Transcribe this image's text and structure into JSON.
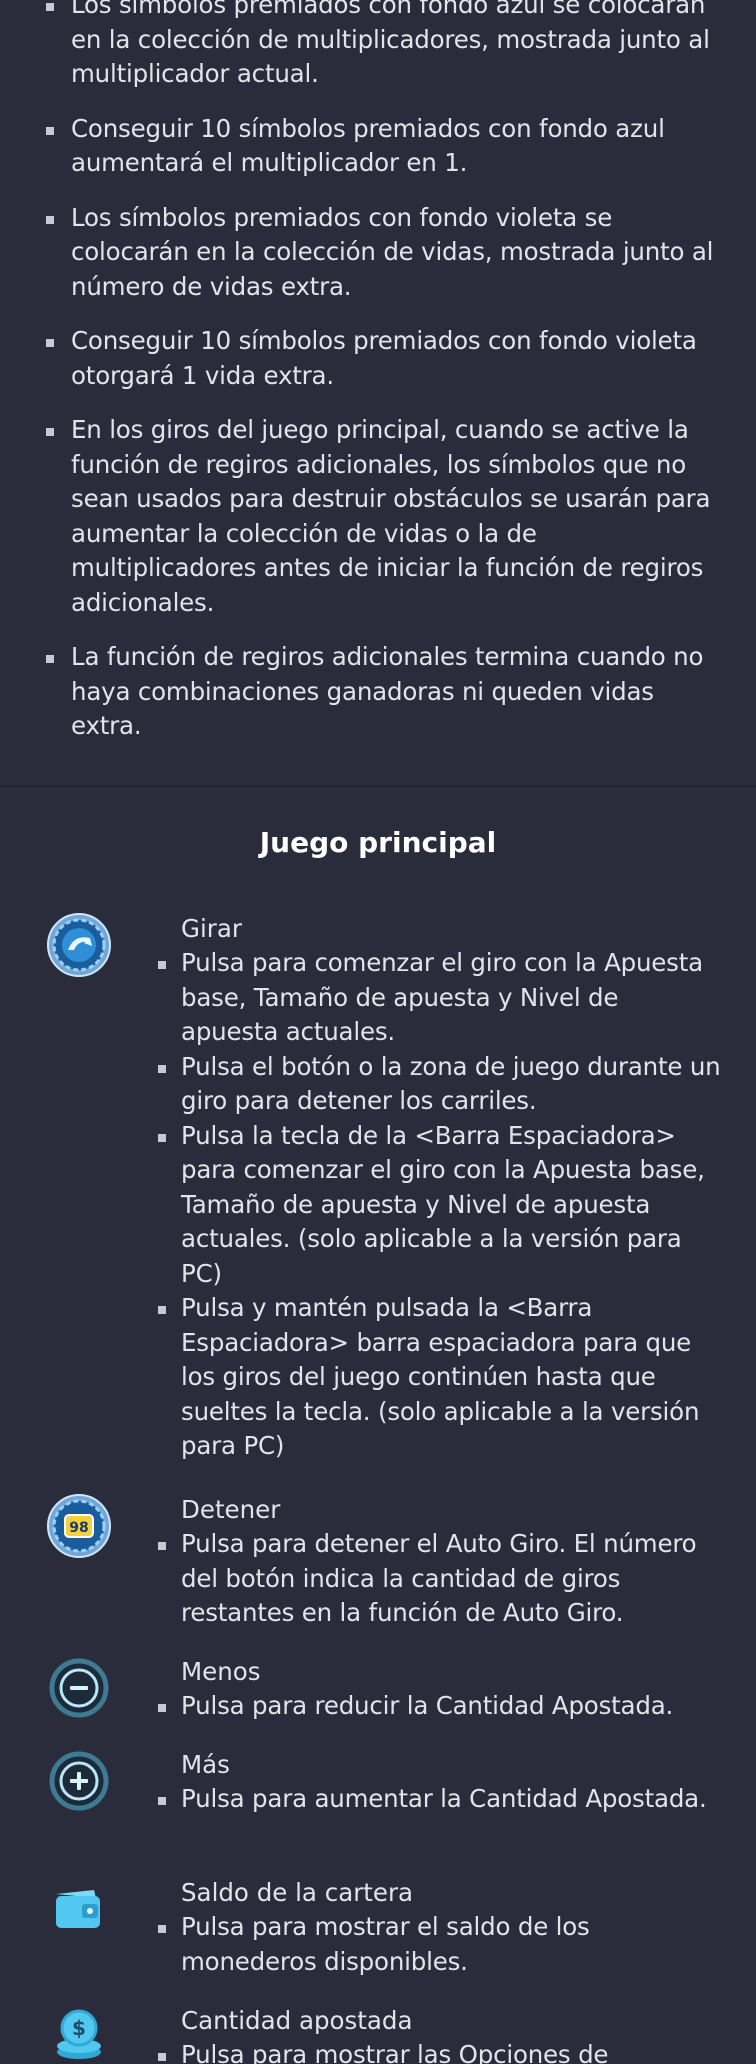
{
  "rules": [
    "Los símbolos premiados con fondo azul se colocarán en la colección de multiplicadores, mostrada junto al multiplicador actual.",
    "Conseguir 10 símbolos premiados con fondo azul aumentará el multiplicador en 1.",
    "Los símbolos premiados con fondo violeta se colocarán en la colección de vidas, mostrada junto al número de vidas extra.",
    "Conseguir 10 símbolos premiados con fondo violeta otorgará 1 vida extra.",
    "En los giros del juego principal, cuando se active la función de regiros adicionales, los símbolos que no sean usados para destruir obstáculos se usarán para aumentar la colección de vidas o la de multiplicadores antes de iniciar la función de regiros adicionales.",
    "La función de regiros adicionales termina cuando no haya combinaciones ganadoras ni queden vidas extra."
  ],
  "main_game": {
    "title": "Juego principal",
    "controls": [
      {
        "icon": "spin-icon",
        "name": "Girar",
        "items": [
          "Pulsa para comenzar el giro con la Apuesta base, Tamaño de apuesta y Nivel de apuesta actuales.",
          "Pulsa el botón o la zona de juego durante un giro para detener los carriles.",
          "Pulsa la tecla de la <Barra Espaciadora> para comenzar el giro con la Apuesta base, Tamaño de apuesta y Nivel de apuesta actuales. (solo aplicable a la versión para PC)",
          "Pulsa y mantén pulsada la <Barra Espaciadora> barra espaciadora para que los giros del juego continúen hasta que sueltes la tecla. (solo aplicable a la versión para PC)"
        ]
      },
      {
        "icon": "stop-autospin-icon",
        "icon_text": "98",
        "name": "Detener",
        "items": [
          "Pulsa para detener el Auto Giro. El número del botón indica la cantidad de giros restantes en la función de Auto Giro."
        ]
      },
      {
        "icon": "minus-icon",
        "name": "Menos",
        "items": [
          "Pulsa para reducir la Cantidad Apostada."
        ]
      },
      {
        "icon": "plus-icon",
        "name": "Más",
        "items": [
          "Pulsa para aumentar la Cantidad Apostada."
        ]
      },
      {
        "icon": "wallet-icon",
        "name": "Saldo de la cartera",
        "items": [
          "Pulsa para mostrar el saldo de los monederos disponibles."
        ]
      },
      {
        "icon": "coins-icon",
        "name": "Cantidad apostada",
        "items": [
          "Pulsa para mostrar las Opciones de"
        ]
      }
    ]
  },
  "colors": {
    "background": "#2b2c3b",
    "text": "#e3e3ea",
    "title": "#ffffff",
    "icon_blue": "#2f8fd6",
    "icon_cyan": "#52c8f0"
  }
}
